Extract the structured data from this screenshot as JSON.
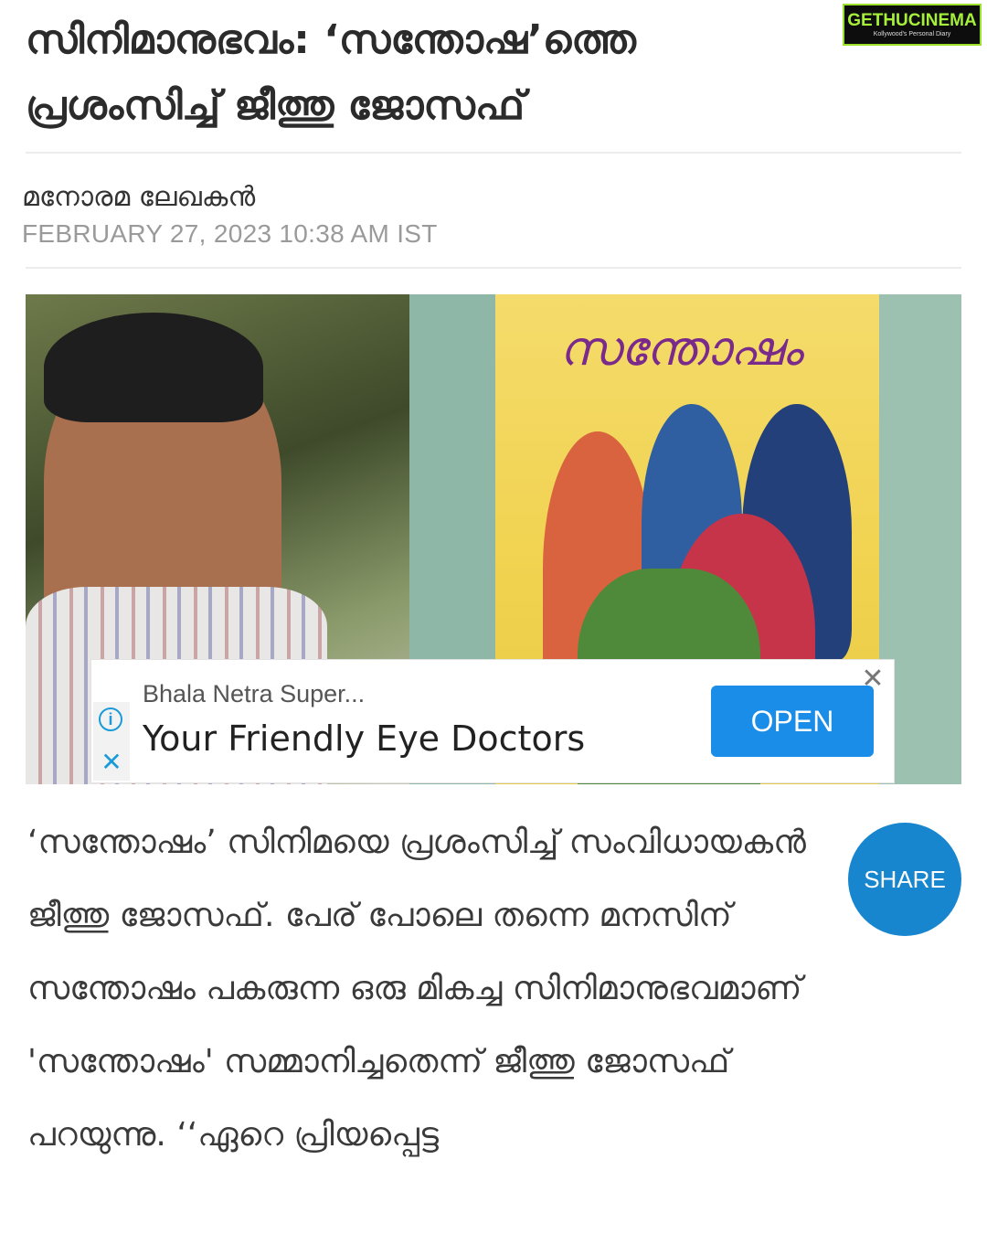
{
  "article": {
    "headline": "സിനിമാനുഭവം: ‘സന്തോഷ’ത്തെ പ്രശംസിച്ച് ജീത്തു ജോസഫ്",
    "author": "മനോരമ ലേഖകൻ",
    "date": "FEBRUARY 27, 2023 10:38 AM IST",
    "body": "‘സന്തോഷം’ സിനിമയെ പ്രശംസിച്ച് സംവിധായകൻ ജീത്തു ജോസഫ്. പേര് പോലെ തന്നെ മനസിന് സന്തോഷം പകരുന്ന  ഒരു മികച്ച സിനിമാനുഭവമാണ് 'സന്തോഷം' സമ്മാനിച്ചതെന്ന് ജീത്തു ജോസഫ് പറയുന്നു. ‘‘ഏറെ പ്രിയപ്പെട്ട"
  },
  "watermark": {
    "logo": "GETHUCINEMA",
    "tagline": "Kollywood's Personal Diary"
  },
  "poster": {
    "title": "സന്തോഷം"
  },
  "ad": {
    "brand": "Bhala Netra Super...",
    "headline": "Your Friendly Eye Doctors",
    "cta": "OPEN",
    "info_icon": "info-icon",
    "close_icon": "close-icon",
    "adchoices_x_icon": "x-icon"
  },
  "share": {
    "label": "SHARE"
  },
  "colors": {
    "share": "#1786cf",
    "ad_cta": "#1a8de8",
    "date": "#9a9a9a"
  }
}
